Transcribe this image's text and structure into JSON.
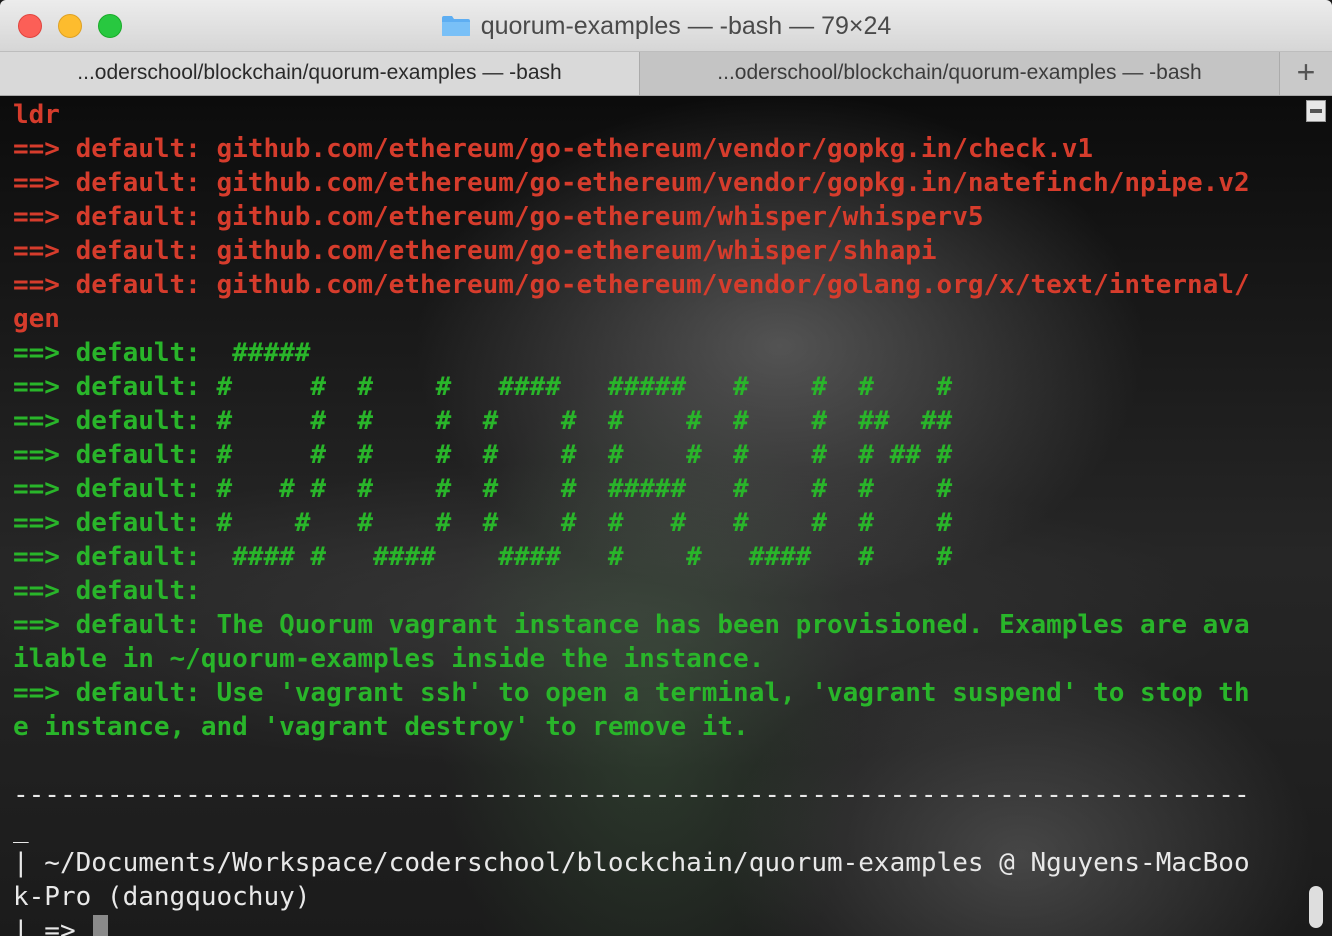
{
  "window": {
    "title": "quorum-examples — -bash — 79×24",
    "tabs": [
      {
        "label": "...oderschool/blockchain/quorum-examples — -bash"
      },
      {
        "label": "...oderschool/blockchain/quorum-examples — -bash"
      }
    ],
    "new_tab_label": "+"
  },
  "terminal": {
    "lines": [
      {
        "text": "ldr",
        "color": "red"
      },
      {
        "text": "==> default: github.com/ethereum/go-ethereum/vendor/gopkg.in/check.v1",
        "color": "red"
      },
      {
        "text": "==> default: github.com/ethereum/go-ethereum/vendor/gopkg.in/natefinch/npipe.v2",
        "color": "red"
      },
      {
        "text": "==> default: github.com/ethereum/go-ethereum/whisper/whisperv5",
        "color": "red"
      },
      {
        "text": "==> default: github.com/ethereum/go-ethereum/whisper/shhapi",
        "color": "red"
      },
      {
        "text": "==> default: github.com/ethereum/go-ethereum/vendor/golang.org/x/text/internal/",
        "color": "red"
      },
      {
        "text": "gen",
        "color": "red"
      },
      {
        "text": "==> default:  #####",
        "color": "green"
      },
      {
        "text": "==> default: #     #  #    #   ####   #####   #    #  #    #",
        "color": "green"
      },
      {
        "text": "==> default: #     #  #    #  #    #  #    #  #    #  ##  ##",
        "color": "green"
      },
      {
        "text": "==> default: #     #  #    #  #    #  #    #  #    #  # ## #",
        "color": "green"
      },
      {
        "text": "==> default: #   # #  #    #  #    #  #####   #    #  #    #",
        "color": "green"
      },
      {
        "text": "==> default: #    #   #    #  #    #  #   #   #    #  #    #",
        "color": "green"
      },
      {
        "text": "==> default:  #### #   ####    ####   #    #   ####   #    #",
        "color": "green"
      },
      {
        "text": "==> default:",
        "color": "green"
      },
      {
        "text": "==> default: The Quorum vagrant instance has been provisioned. Examples are ava",
        "color": "green"
      },
      {
        "text": "ilable in ~/quorum-examples inside the instance.",
        "color": "green"
      },
      {
        "text": "==> default: Use 'vagrant ssh' to open a terminal, 'vagrant suspend' to stop th",
        "color": "green"
      },
      {
        "text": "e instance, and 'vagrant destroy' to remove it.",
        "color": "green"
      },
      {
        "text": "",
        "color": "white"
      },
      {
        "text": "-------------------------------------------------------------------------------",
        "color": "white"
      },
      {
        "text": "_",
        "color": "white"
      },
      {
        "text": "| ~/Documents/Workspace/coderschool/blockchain/quorum-examples @ Nguyens-MacBoo",
        "color": "white"
      },
      {
        "text": "k-Pro (dangquochuy)",
        "color": "white"
      }
    ],
    "prompt": "| => "
  },
  "colors": {
    "red": "#d63c2c",
    "green": "#29b52a",
    "white": "#e8e8e8"
  },
  "icons": {
    "title_icon": "folder-icon"
  }
}
